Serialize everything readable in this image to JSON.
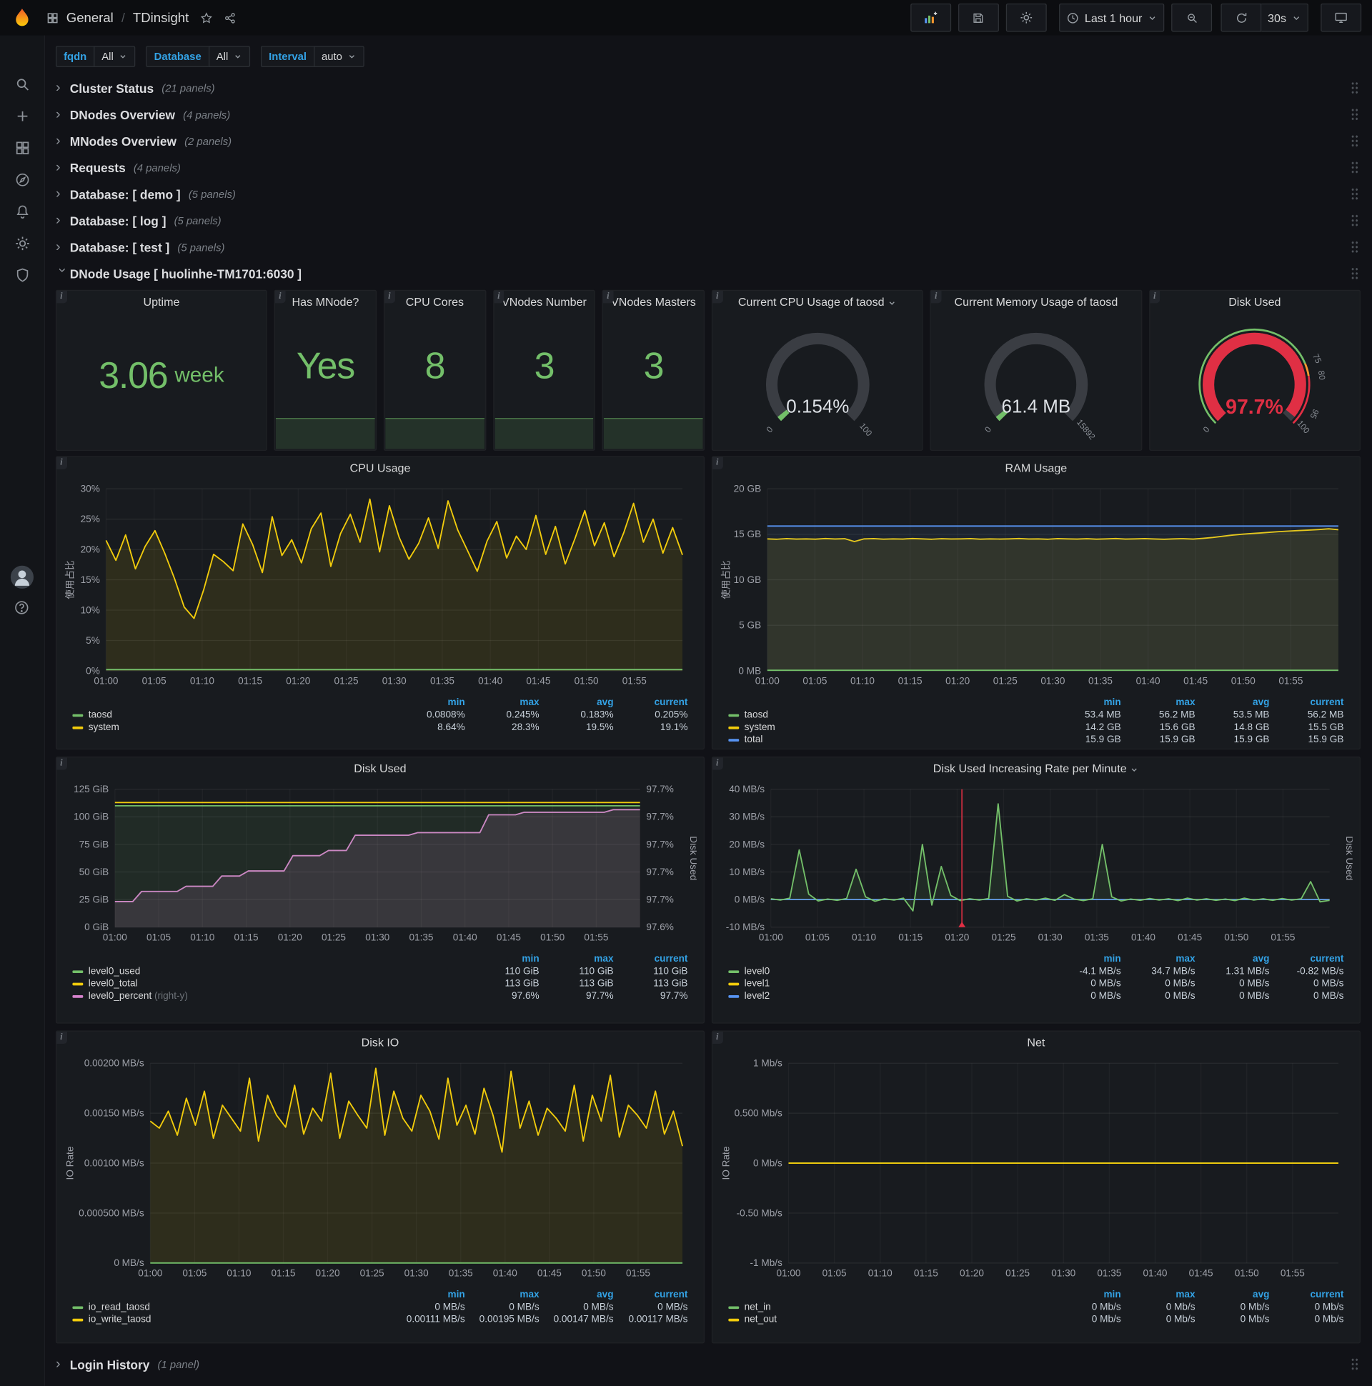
{
  "nav": {
    "breadcrumb": {
      "section": "General",
      "separator": "/",
      "title": "TDinsight"
    },
    "time_range": "Last 1 hour",
    "refresh": "30s"
  },
  "variables": [
    {
      "label": "fqdn",
      "value": "All"
    },
    {
      "label": "Database",
      "value": "All"
    },
    {
      "label": "Interval",
      "value": "auto"
    }
  ],
  "rows_top": [
    {
      "title": "Cluster Status",
      "count": "(21 panels)"
    },
    {
      "title": "DNodes Overview",
      "count": "(4 panels)"
    },
    {
      "title": "MNodes Overview",
      "count": "(2 panels)"
    },
    {
      "title": "Requests",
      "count": "(4 panels)"
    },
    {
      "title": "Database: [ demo ]",
      "count": "(5 panels)"
    },
    {
      "title": "Database: [ log ]",
      "count": "(5 panels)"
    },
    {
      "title": "Database: [ test ]",
      "count": "(5 panels)"
    }
  ],
  "expanded_row": {
    "title": "DNode Usage [ huolinhe-TM1701:6030 ]"
  },
  "bottom_row": {
    "title": "Login History",
    "count": "(1 panel)"
  },
  "stats": [
    {
      "title": "Uptime",
      "value": "3.06",
      "unit": "week"
    },
    {
      "title": "Has MNode?",
      "value": "Yes"
    },
    {
      "title": "CPU Cores",
      "value": "8"
    },
    {
      "title": "VNodes Number",
      "value": "3"
    },
    {
      "title": "VNodes Masters",
      "value": "3"
    }
  ],
  "gauges": [
    {
      "title": "Current CPU Usage of taosd",
      "value": "0.154%",
      "min": "0",
      "max": "100"
    },
    {
      "title": "Current Memory Usage of taosd",
      "value": "61.4 MB",
      "min": "0",
      "max": "15892"
    },
    {
      "title": "Disk Used",
      "value": "97.7%",
      "min": "0",
      "max": "100",
      "thresholds": [
        "75",
        "80",
        "95"
      ]
    }
  ],
  "colors": {
    "green": "#73bf69",
    "yellow": "#f2cc0c",
    "blue": "#5794f2",
    "pink": "#d683ce",
    "red": "#e02f44",
    "legend_header": "#33a2e5",
    "stat_green": "#73bf69"
  },
  "chart_data": [
    {
      "type": "line",
      "title": "CPU Usage",
      "x_ticks": [
        "01:00",
        "01:05",
        "01:10",
        "01:15",
        "01:20",
        "01:25",
        "01:30",
        "01:35",
        "01:40",
        "01:45",
        "01:50",
        "01:55"
      ],
      "x_range": [
        "01:00",
        "02:00"
      ],
      "y_ticks": [
        "30%",
        "25%",
        "20%",
        "15%",
        "10%",
        "5%",
        "0%"
      ],
      "ylim": [
        0,
        30
      ],
      "y_title_left": "使用占比",
      "pad_left": 48,
      "pad_right": 16,
      "legend": {
        "headers": [
          "min",
          "max",
          "avg",
          "current"
        ],
        "rows": [
          {
            "name": "taosd",
            "color": "#73bf69",
            "values": [
              "0.0808%",
              "0.245%",
              "0.183%",
              "0.205%"
            ]
          },
          {
            "name": "system",
            "color": "#f2cc0c",
            "values": [
              "8.64%",
              "28.3%",
              "19.5%",
              "19.1%"
            ]
          }
        ]
      },
      "series": [
        {
          "name": "system",
          "color": "#f2cc0c",
          "fill": "rgba(242,204,12,0.10)",
          "values": [
            21.5,
            18.2,
            22.4,
            16.8,
            20.5,
            23.1,
            19.4,
            15.2,
            10.5,
            8.64,
            13.4,
            19.2,
            18.0,
            16.5,
            24.2,
            20.8,
            16.2,
            25.4,
            19.0,
            21.6,
            17.8,
            23.4,
            26.0,
            17.2,
            22.6,
            25.8,
            21.2,
            28.3,
            19.6,
            27.2,
            22.0,
            18.4,
            21.0,
            25.2,
            20.2,
            28.0,
            23.2,
            19.8,
            16.4,
            21.4,
            24.6,
            18.6,
            22.2,
            20.0,
            25.6,
            19.2,
            23.8,
            17.6,
            21.8,
            26.4,
            20.6,
            24.4,
            18.8,
            22.8,
            27.6,
            21.2,
            25.0,
            19.4,
            23.6,
            19.1
          ]
        },
        {
          "name": "taosd",
          "color": "#73bf69",
          "fill": "rgba(115,191,105,0.10)",
          "const": 0.2,
          "n": 60
        }
      ]
    },
    {
      "type": "line",
      "title": "RAM Usage",
      "x_ticks": [
        "01:00",
        "01:05",
        "01:10",
        "01:15",
        "01:20",
        "01:25",
        "01:30",
        "01:35",
        "01:40",
        "01:45",
        "01:50",
        "01:55"
      ],
      "x_range": [
        "01:00",
        "02:00"
      ],
      "y_ticks": [
        "20 GB",
        "15 GB",
        "10 GB",
        "5 GB",
        "0 MB"
      ],
      "ylim": [
        0,
        20
      ],
      "y_title_left": "使用占比",
      "pad_left": 54,
      "pad_right": 16,
      "legend": {
        "headers": [
          "min",
          "max",
          "avg",
          "current"
        ],
        "rows": [
          {
            "name": "taosd",
            "color": "#73bf69",
            "values": [
              "53.4 MB",
              "56.2 MB",
              "53.5 MB",
              "56.2 MB"
            ]
          },
          {
            "name": "system",
            "color": "#f2cc0c",
            "values": [
              "14.2 GB",
              "15.6 GB",
              "14.8 GB",
              "15.5 GB"
            ]
          },
          {
            "name": "total",
            "color": "#5794f2",
            "values": [
              "15.9 GB",
              "15.9 GB",
              "15.9 GB",
              "15.9 GB"
            ]
          }
        ]
      },
      "series": [
        {
          "name": "system",
          "color": "#f2cc0c",
          "fill": "rgba(242,204,12,0.10)",
          "values": [
            14.5,
            14.46,
            14.52,
            14.48,
            14.5,
            14.47,
            14.53,
            14.49,
            14.51,
            14.2,
            14.5,
            14.52,
            14.47,
            14.5,
            14.48,
            14.53,
            14.5,
            14.46,
            14.51,
            14.49,
            14.5,
            14.52,
            14.47,
            14.5,
            14.48,
            14.5,
            14.53,
            14.49,
            14.5,
            14.46,
            14.52,
            14.5,
            14.48,
            14.51,
            14.47,
            14.5,
            14.53,
            14.48,
            14.5,
            14.52,
            14.49,
            14.46,
            14.5,
            14.51,
            14.48,
            14.55,
            14.65,
            14.78,
            14.9,
            15.0,
            15.08,
            15.15,
            15.22,
            15.3,
            15.36,
            15.42,
            15.47,
            15.52,
            15.6,
            15.5
          ]
        },
        {
          "name": "total",
          "color": "#5794f2",
          "fill": "rgba(87,148,242,0.08)",
          "const": 15.9,
          "n": 60
        },
        {
          "name": "taosd",
          "color": "#73bf69",
          "fill": "rgba(115,191,105,0.10)",
          "const": 0.055,
          "n": 60
        }
      ]
    },
    {
      "type": "line",
      "title": "Disk Used",
      "x_ticks": [
        "01:00",
        "01:05",
        "01:10",
        "01:15",
        "01:20",
        "01:25",
        "01:30",
        "01:35",
        "01:40",
        "01:45",
        "01:50",
        "01:55"
      ],
      "x_range": [
        "01:00",
        "02:00"
      ],
      "y_ticks": [
        "125 GiB",
        "100 GiB",
        "75 GiB",
        "50 GiB",
        "25 GiB",
        "0 GiB"
      ],
      "y_ticks_right": [
        "97.7%",
        "97.7%",
        "97.7%",
        "97.7%",
        "97.7%",
        "97.6%"
      ],
      "ylim": [
        0,
        125
      ],
      "y_title_right": "Disk Used",
      "pad_left": 58,
      "pad_right": 64,
      "legend": {
        "headers": [
          "min",
          "max",
          "current"
        ],
        "rows": [
          {
            "name": "level0_used",
            "color": "#73bf69",
            "values": [
              "110 GiB",
              "110 GiB",
              "110 GiB"
            ]
          },
          {
            "name": "level0_total",
            "color": "#f2cc0c",
            "values": [
              "113 GiB",
              "113 GiB",
              "113 GiB"
            ]
          },
          {
            "name": "level0_percent",
            "color": "#d683ce",
            "note": "(right-y)",
            "values": [
              "97.6%",
              "97.7%",
              "97.7%"
            ]
          }
        ]
      },
      "series": [
        {
          "name": "level0_percent",
          "color": "#d683ce",
          "fill": "rgba(214,131,206,0.14)",
          "range": [
            97.595,
            97.622
          ],
          "values": [
            97.6,
            97.6,
            97.6,
            97.602,
            97.602,
            97.602,
            97.602,
            97.602,
            97.603,
            97.603,
            97.603,
            97.603,
            97.605,
            97.605,
            97.605,
            97.606,
            97.606,
            97.606,
            97.606,
            97.606,
            97.609,
            97.609,
            97.609,
            97.609,
            97.61,
            97.61,
            97.61,
            97.613,
            97.613,
            97.613,
            97.613,
            97.613,
            97.613,
            97.613,
            97.6135,
            97.6135,
            97.6135,
            97.6135,
            97.6135,
            97.6135,
            97.6135,
            97.6135,
            97.617,
            97.617,
            97.617,
            97.617,
            97.6175,
            97.6175,
            97.6175,
            97.6175,
            97.6175,
            97.6175,
            97.6175,
            97.6175,
            97.6175,
            97.6175,
            97.618,
            97.618,
            97.618,
            97.618
          ]
        },
        {
          "name": "level0_used",
          "color": "#73bf69",
          "fill": "rgba(115,191,105,0.10)",
          "const": 110,
          "n": 60
        },
        {
          "name": "level0_total",
          "color": "#f2cc0c",
          "const": 113,
          "n": 60
        }
      ]
    },
    {
      "type": "line",
      "title": "Disk Used Increasing Rate per Minute",
      "x_ticks": [
        "01:00",
        "01:05",
        "01:10",
        "01:15",
        "01:20",
        "01:25",
        "01:30",
        "01:35",
        "01:40",
        "01:45",
        "01:50",
        "01:55"
      ],
      "x_range": [
        "01:00",
        "02:00"
      ],
      "y_ticks": [
        "40 MB/s",
        "30 MB/s",
        "20 MB/s",
        "10 MB/s",
        "0 MB/s",
        "-10 MB/s"
      ],
      "ylim": [
        -10,
        40
      ],
      "y_title_right": "Disk Used",
      "pad_left": 58,
      "pad_right": 26,
      "annotation_x": 0.342,
      "legend": {
        "headers": [
          "min",
          "max",
          "avg",
          "current"
        ],
        "rows": [
          {
            "name": "level0",
            "color": "#73bf69",
            "values": [
              "-4.1 MB/s",
              "34.7 MB/s",
              "1.31 MB/s",
              "-0.82 MB/s"
            ]
          },
          {
            "name": "level1",
            "color": "#f2cc0c",
            "values": [
              "0 MB/s",
              "0 MB/s",
              "0 MB/s",
              "0 MB/s"
            ]
          },
          {
            "name": "level2",
            "color": "#5794f2",
            "values": [
              "0 MB/s",
              "0 MB/s",
              "0 MB/s",
              "0 MB/s"
            ]
          }
        ]
      },
      "series": [
        {
          "name": "level1",
          "color": "#f2cc0c",
          "const": 0,
          "n": 60
        },
        {
          "name": "level2",
          "color": "#5794f2",
          "const": 0,
          "n": 60
        },
        {
          "name": "level0",
          "color": "#73bf69",
          "fill": "rgba(115,191,105,0.10)",
          "values": [
            0.3,
            -0.2,
            0.5,
            18,
            2,
            -0.5,
            0.2,
            -0.3,
            0.4,
            11,
            1,
            -0.6,
            0.3,
            -0.2,
            0.5,
            -4.1,
            20,
            -2,
            12,
            1.5,
            -0.4,
            0.3,
            -0.2,
            0.4,
            34.7,
            1.2,
            -0.5,
            0.3,
            -0.2,
            0.5,
            -0.3,
            1.8,
            0.2,
            -0.4,
            0.3,
            20,
            1,
            -0.5,
            0.2,
            -0.3,
            0.4,
            -0.2,
            0.3,
            -0.4,
            0.5,
            -0.2,
            0.3,
            -0.3,
            0.2,
            -0.4,
            0.5,
            -0.2,
            0.3,
            -0.3,
            0.4,
            -0.2,
            0.3,
            6.5,
            -0.82,
            -0.3
          ]
        }
      ]
    },
    {
      "type": "line",
      "title": "Disk IO",
      "x_ticks": [
        "01:00",
        "01:05",
        "01:10",
        "01:15",
        "01:20",
        "01:25",
        "01:30",
        "01:35",
        "01:40",
        "01:45",
        "01:50",
        "01:55"
      ],
      "x_range": [
        "01:00",
        "02:00"
      ],
      "y_ticks": [
        "0.00200 MB/s",
        "0.00150 MB/s",
        "0.00100 MB/s",
        "0.000500 MB/s",
        "0 MB/s"
      ],
      "ylim": [
        0,
        0.002
      ],
      "y_title_left": "IO Rate",
      "pad_left": 98,
      "pad_right": 16,
      "legend": {
        "headers": [
          "min",
          "max",
          "avg",
          "current"
        ],
        "rows": [
          {
            "name": "io_read_taosd",
            "color": "#73bf69",
            "values": [
              "0 MB/s",
              "0 MB/s",
              "0 MB/s",
              "0 MB/s"
            ]
          },
          {
            "name": "io_write_taosd",
            "color": "#f2cc0c",
            "values": [
              "0.00111 MB/s",
              "0.00195 MB/s",
              "0.00147 MB/s",
              "0.00117 MB/s"
            ]
          }
        ]
      },
      "series": [
        {
          "name": "io_write_taosd",
          "color": "#f2cc0c",
          "fill": "rgba(242,204,12,0.10)",
          "values": [
            0.00142,
            0.00135,
            0.00152,
            0.00128,
            0.00165,
            0.00138,
            0.00172,
            0.00125,
            0.00158,
            0.00145,
            0.00132,
            0.00185,
            0.00122,
            0.00168,
            0.00148,
            0.00136,
            0.00178,
            0.00129,
            0.00155,
            0.00142,
            0.0019,
            0.00125,
            0.00162,
            0.00148,
            0.00135,
            0.00195,
            0.00128,
            0.00172,
            0.00145,
            0.00132,
            0.00168,
            0.00152,
            0.00124,
            0.00185,
            0.00138,
            0.00158,
            0.00129,
            0.00175,
            0.00148,
            0.00111,
            0.00192,
            0.00135,
            0.00162,
            0.00128,
            0.00155,
            0.00145,
            0.00132,
            0.00178,
            0.00122,
            0.00168,
            0.00142,
            0.00188,
            0.00126,
            0.00158,
            0.00148,
            0.00135,
            0.00172,
            0.00129,
            0.00152,
            0.00117
          ]
        },
        {
          "name": "io_read_taosd",
          "color": "#73bf69",
          "fill": "rgba(115,191,105,0.10)",
          "const": 0,
          "n": 60
        }
      ]
    },
    {
      "type": "line",
      "title": "Net",
      "x_ticks": [
        "01:00",
        "01:05",
        "01:10",
        "01:15",
        "01:20",
        "01:25",
        "01:30",
        "01:35",
        "01:40",
        "01:45",
        "01:50",
        "01:55"
      ],
      "x_range": [
        "01:00",
        "02:00"
      ],
      "y_ticks": [
        "1 Mb/s",
        "0.500 Mb/s",
        "0 Mb/s",
        "-0.50 Mb/s",
        "-1 Mb/s"
      ],
      "ylim": [
        -1,
        1
      ],
      "y_title_left": "IO Rate",
      "pad_left": 78,
      "pad_right": 16,
      "legend": {
        "headers": [
          "min",
          "max",
          "avg",
          "current"
        ],
        "rows": [
          {
            "name": "net_in",
            "color": "#73bf69",
            "values": [
              "0 Mb/s",
              "0 Mb/s",
              "0 Mb/s",
              "0 Mb/s"
            ]
          },
          {
            "name": "net_out",
            "color": "#f2cc0c",
            "values": [
              "0 Mb/s",
              "0 Mb/s",
              "0 Mb/s",
              "0 Mb/s"
            ]
          }
        ]
      },
      "series": [
        {
          "name": "net_in",
          "color": "#73bf69",
          "const": 0,
          "n": 60
        },
        {
          "name": "net_out",
          "color": "#f2cc0c",
          "const": 0,
          "n": 60
        }
      ]
    }
  ]
}
